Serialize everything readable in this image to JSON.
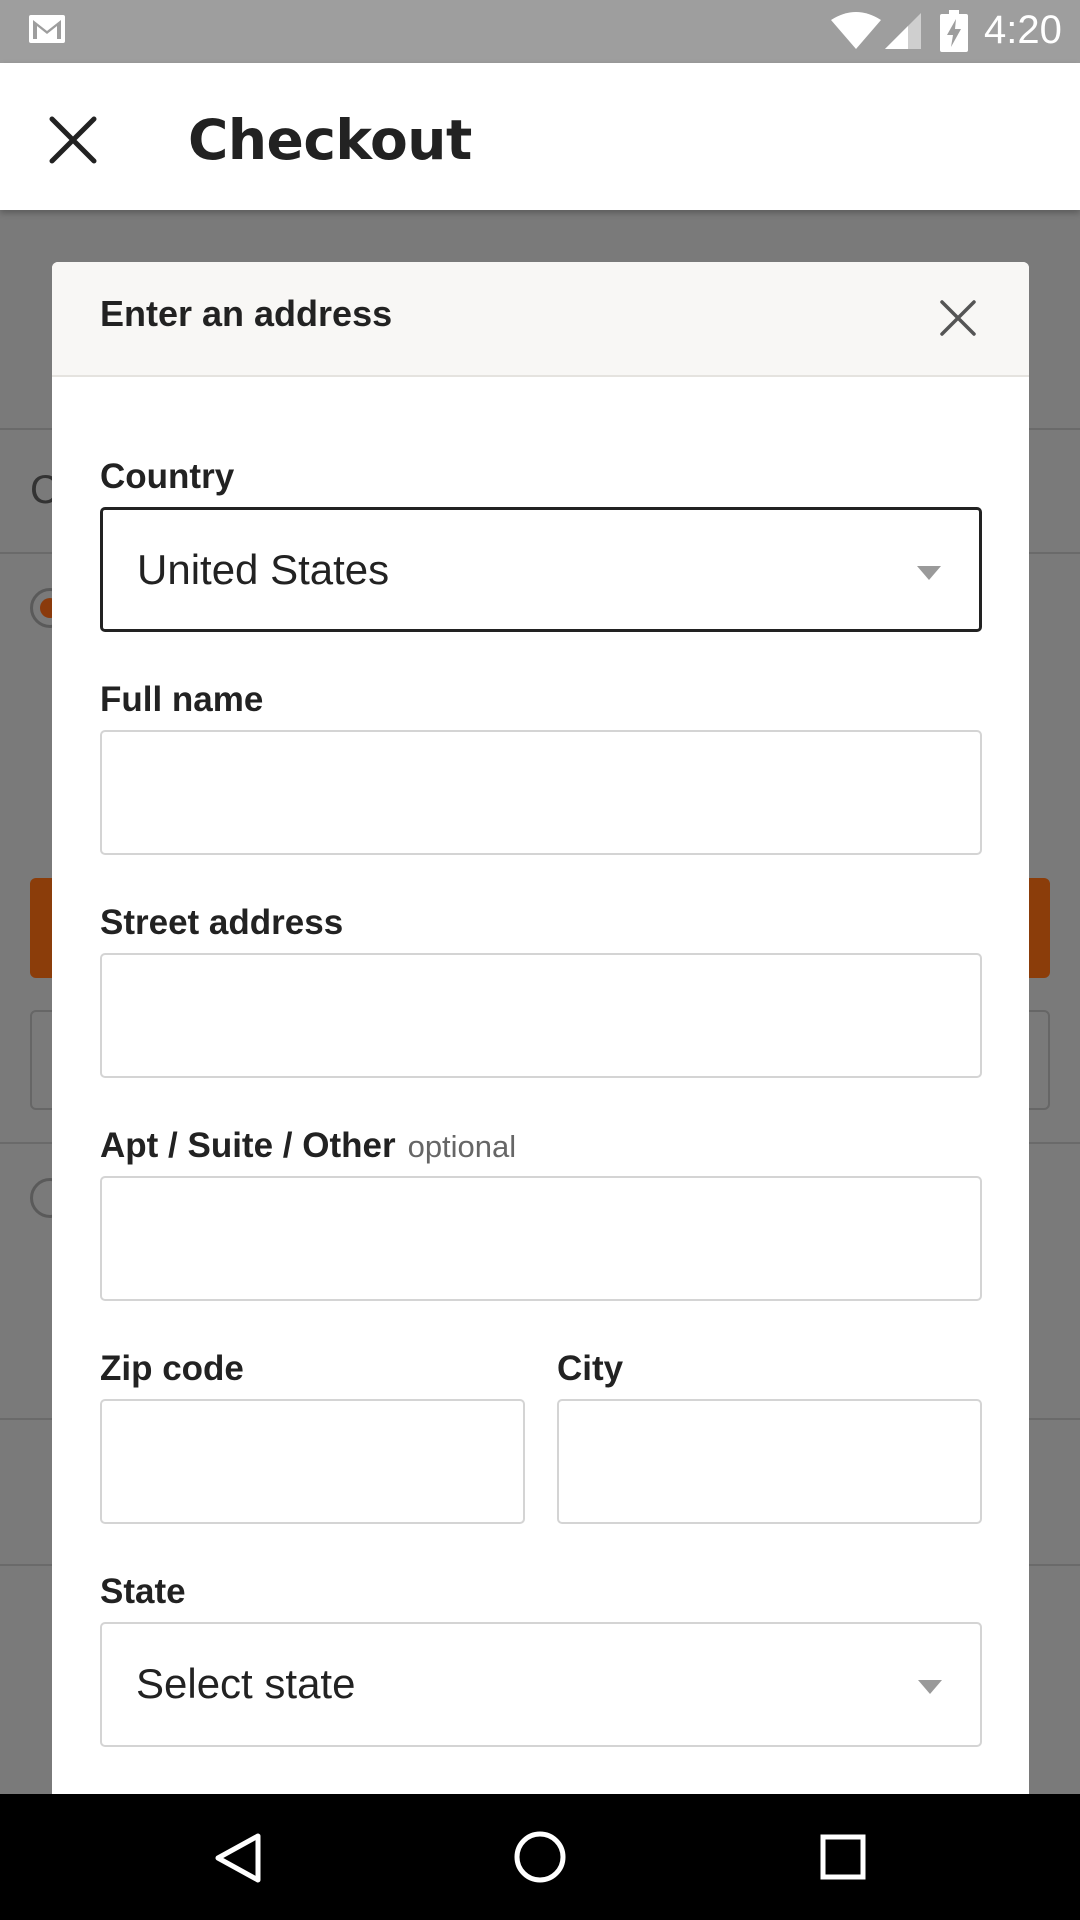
{
  "status_bar": {
    "time": "4:20",
    "icons": [
      "gmail-icon",
      "wifi-icon",
      "signal-icon",
      "battery-charging-icon"
    ]
  },
  "app_bar": {
    "title": "Checkout",
    "close_icon": "close-icon"
  },
  "background": {
    "heading_fragment": "C"
  },
  "modal": {
    "title": "Enter an address",
    "close_icon": "close-icon",
    "fields": {
      "country": {
        "label": "Country",
        "value": "United States"
      },
      "full_name": {
        "label": "Full name",
        "value": ""
      },
      "street": {
        "label": "Street address",
        "value": ""
      },
      "apt": {
        "label": "Apt / Suite / Other",
        "optional": "optional",
        "value": ""
      },
      "zip": {
        "label": "Zip code",
        "value": ""
      },
      "city": {
        "label": "City",
        "value": ""
      },
      "state": {
        "label": "State",
        "placeholder": "Select state"
      }
    }
  },
  "nav_bar": {
    "icons": [
      "back-icon",
      "home-icon",
      "recents-icon"
    ]
  },
  "colors": {
    "accent": "#c2500f",
    "overlay": "#7b7b7b",
    "header_bg": "#f8f7f5"
  }
}
